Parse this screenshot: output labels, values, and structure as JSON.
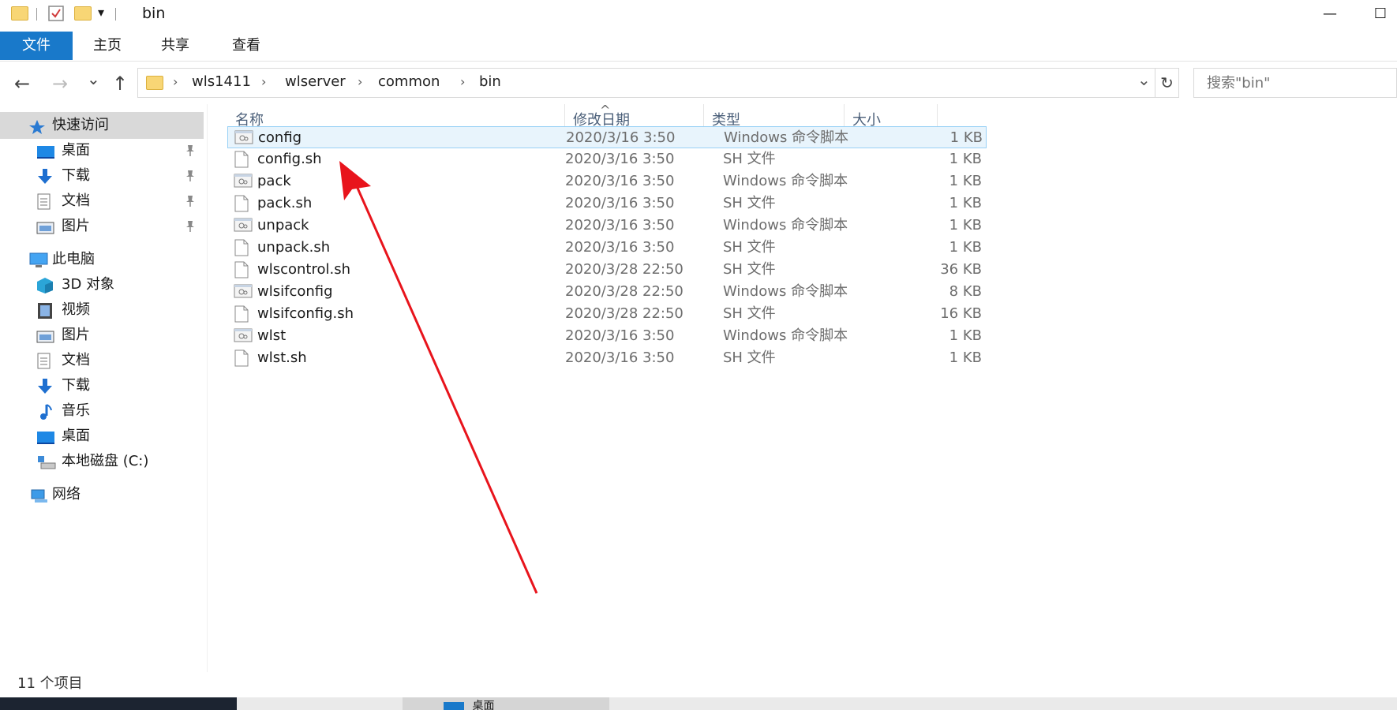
{
  "window": {
    "title": "bin",
    "minimize_glyph": "—",
    "maximize_glyph": "☐"
  },
  "quick_access_toolbar": {
    "dropdown_glyph": "▾"
  },
  "ribbon": {
    "tabs": [
      {
        "label": "文件",
        "active": true
      },
      {
        "label": "主页",
        "active": false
      },
      {
        "label": "共享",
        "active": false
      },
      {
        "label": "查看",
        "active": false
      }
    ]
  },
  "nav": {
    "back_glyph": "←",
    "forward_glyph": "→",
    "recent_glyph": "⌄",
    "up_glyph": "↑",
    "breadcrumb": [
      "wls1411",
      "wlserver",
      "common",
      "bin"
    ],
    "separator_glyph": "›",
    "dropdown_glyph": "⌄",
    "refresh_glyph": "↻",
    "search_placeholder": "搜索\"bin\""
  },
  "sidebar": {
    "items": [
      {
        "label": "快速访问",
        "icon": "star-icon",
        "pinned": false,
        "level": 0,
        "selected": true
      },
      {
        "label": "桌面",
        "icon": "desktop-icon",
        "pinned": true,
        "level": 1,
        "selected": false
      },
      {
        "label": "下载",
        "icon": "download-icon",
        "pinned": true,
        "level": 1,
        "selected": false
      },
      {
        "label": "文档",
        "icon": "document-icon",
        "pinned": true,
        "level": 1,
        "selected": false
      },
      {
        "label": "图片",
        "icon": "picture-icon",
        "pinned": true,
        "level": 1,
        "selected": false
      },
      {
        "label": "此电脑",
        "icon": "computer-icon",
        "pinned": false,
        "level": 0,
        "selected": false
      },
      {
        "label": "3D 对象",
        "icon": "3d-objects-icon",
        "pinned": false,
        "level": 1,
        "selected": false
      },
      {
        "label": "视频",
        "icon": "video-icon",
        "pinned": false,
        "level": 1,
        "selected": false
      },
      {
        "label": "图片",
        "icon": "picture-icon",
        "pinned": false,
        "level": 1,
        "selected": false
      },
      {
        "label": "文档",
        "icon": "document-icon",
        "pinned": false,
        "level": 1,
        "selected": false
      },
      {
        "label": "下载",
        "icon": "download-icon",
        "pinned": false,
        "level": 1,
        "selected": false
      },
      {
        "label": "音乐",
        "icon": "music-icon",
        "pinned": false,
        "level": 1,
        "selected": false
      },
      {
        "label": "桌面",
        "icon": "desktop-icon",
        "pinned": false,
        "level": 1,
        "selected": false
      },
      {
        "label": "本地磁盘 (C:)",
        "icon": "drive-icon",
        "pinned": false,
        "level": 1,
        "selected": false
      },
      {
        "label": "网络",
        "icon": "network-icon",
        "pinned": false,
        "level": 0,
        "selected": false
      }
    ],
    "pin_glyph": "📌"
  },
  "file_list": {
    "columns": [
      "名称",
      "修改日期",
      "类型",
      "大小"
    ],
    "sort_caret": "^",
    "rows": [
      {
        "name": "config",
        "date": "2020/3/16 3:50",
        "type": "Windows 命令脚本",
        "size": "1 KB",
        "kind": "script",
        "selected": true
      },
      {
        "name": "config.sh",
        "date": "2020/3/16 3:50",
        "type": "SH 文件",
        "size": "1 KB",
        "kind": "file",
        "selected": false
      },
      {
        "name": "pack",
        "date": "2020/3/16 3:50",
        "type": "Windows 命令脚本",
        "size": "1 KB",
        "kind": "script",
        "selected": false
      },
      {
        "name": "pack.sh",
        "date": "2020/3/16 3:50",
        "type": "SH 文件",
        "size": "1 KB",
        "kind": "file",
        "selected": false
      },
      {
        "name": "unpack",
        "date": "2020/3/16 3:50",
        "type": "Windows 命令脚本",
        "size": "1 KB",
        "kind": "script",
        "selected": false
      },
      {
        "name": "unpack.sh",
        "date": "2020/3/16 3:50",
        "type": "SH 文件",
        "size": "1 KB",
        "kind": "file",
        "selected": false
      },
      {
        "name": "wlscontrol.sh",
        "date": "2020/3/28 22:50",
        "type": "SH 文件",
        "size": "36 KB",
        "kind": "file",
        "selected": false
      },
      {
        "name": "wlsifconfig",
        "date": "2020/3/28 22:50",
        "type": "Windows 命令脚本",
        "size": "8 KB",
        "kind": "script",
        "selected": false
      },
      {
        "name": "wlsifconfig.sh",
        "date": "2020/3/28 22:50",
        "type": "SH 文件",
        "size": "16 KB",
        "kind": "file",
        "selected": false
      },
      {
        "name": "wlst",
        "date": "2020/3/16 3:50",
        "type": "Windows 命令脚本",
        "size": "1 KB",
        "kind": "script",
        "selected": false
      },
      {
        "name": "wlst.sh",
        "date": "2020/3/16 3:50",
        "type": "SH 文件",
        "size": "1 KB",
        "kind": "file",
        "selected": false
      }
    ]
  },
  "status_bar": {
    "item_count": "11 个项目"
  },
  "taskbar": {
    "item_label": "桌面"
  },
  "colors": {
    "accent": "#1979ca",
    "selection_bg": "#e8f4fc",
    "selection_border": "#99d1f6",
    "annotation_arrow": "#e8141c"
  }
}
